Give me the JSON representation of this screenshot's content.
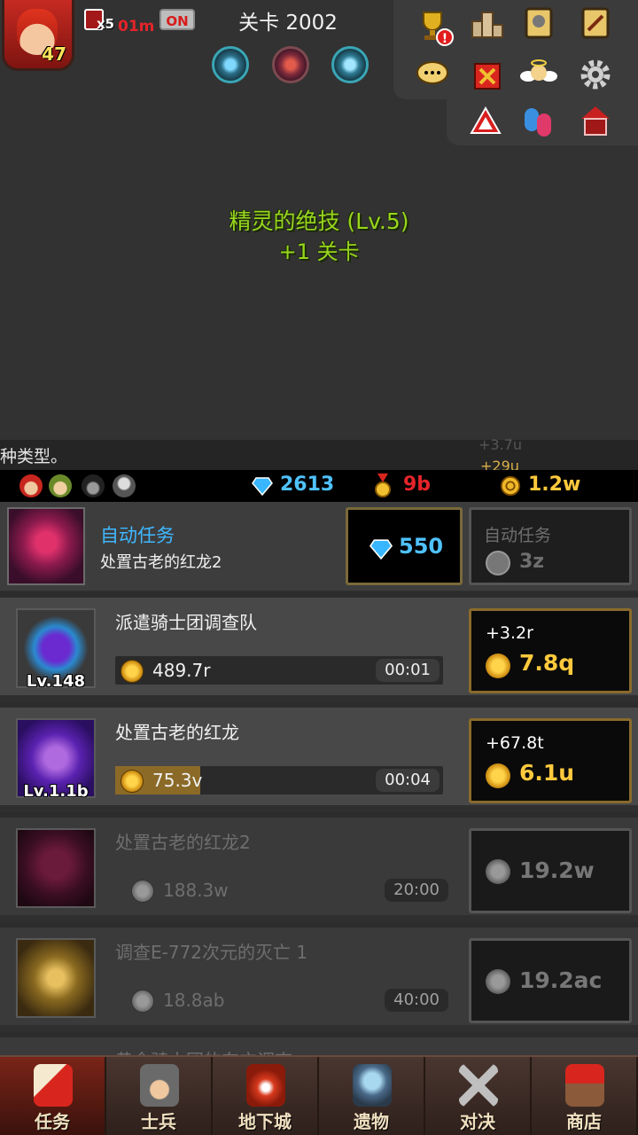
{
  "header": {
    "hero_level": "47",
    "multiplier": "x5",
    "multiplier_time": "01m",
    "toggle_state": "ON",
    "stage_title": "关卡 2002",
    "skill_icons": [
      "spirit-skill-icon",
      "flame-skill-icon",
      "spirit-skill-icon"
    ]
  },
  "menu_icons": [
    "trophy-icon",
    "ranking-icon",
    "knight-book-icon",
    "sword-book-icon",
    "chat-icon",
    "shield-gift-icon",
    "angel-icon",
    "settings-icon",
    "warning-icon",
    "friends-icon",
    "mailbox-icon"
  ],
  "notification": {
    "skill": "精灵的绝技 (Lv.5)",
    "effect": "+1 关卡"
  },
  "ticker": {
    "text": "种类型。",
    "float_top": "+3.7u",
    "float_bottom": "+29u"
  },
  "resources": {
    "gems": "2613",
    "medals": "9b",
    "gold": "1.2w"
  },
  "auto_quest": {
    "title": "自动任务",
    "subtitle": "处置古老的红龙2",
    "gem_cost": "550",
    "cost_label": "自动任务",
    "cost_value": "3z"
  },
  "quests": [
    {
      "title": "派遣骑士团调查队",
      "level": "Lv.148",
      "reward": "489.7r",
      "timer": "00:01",
      "progress": 0.0,
      "gain": "+3.2r",
      "cost": "7.8q",
      "locked": false
    },
    {
      "title": "处置古老的红龙",
      "level": "Lv.1.1b",
      "reward": "75.3v",
      "timer": "00:04",
      "progress": 0.26,
      "gain": "+67.8t",
      "cost": "6.1u",
      "locked": false
    },
    {
      "title": "处置古老的红龙2",
      "level": "",
      "reward": "188.3w",
      "timer": "20:00",
      "progress": 0.0,
      "gain": "",
      "cost": "19.2w",
      "locked": true
    },
    {
      "title": "调查E-772次元的灭亡 1",
      "level": "",
      "reward": "18.8ab",
      "timer": "40:00",
      "progress": 0.0,
      "gain": "",
      "cost": "19.2ac",
      "locked": true
    }
  ],
  "partial_row_title": "黄金骑士团的东方调查",
  "tabs": [
    {
      "label": "任务",
      "active": true
    },
    {
      "label": "士兵",
      "active": false
    },
    {
      "label": "地下城",
      "active": false
    },
    {
      "label": "遗物",
      "active": false
    },
    {
      "label": "对决",
      "active": false
    },
    {
      "label": "商店",
      "active": false
    }
  ],
  "colors": {
    "accent_blue": "#3fb8ff",
    "gold": "#ffc93c",
    "skill_green": "#98d61e",
    "medal_red": "#e5242a"
  }
}
